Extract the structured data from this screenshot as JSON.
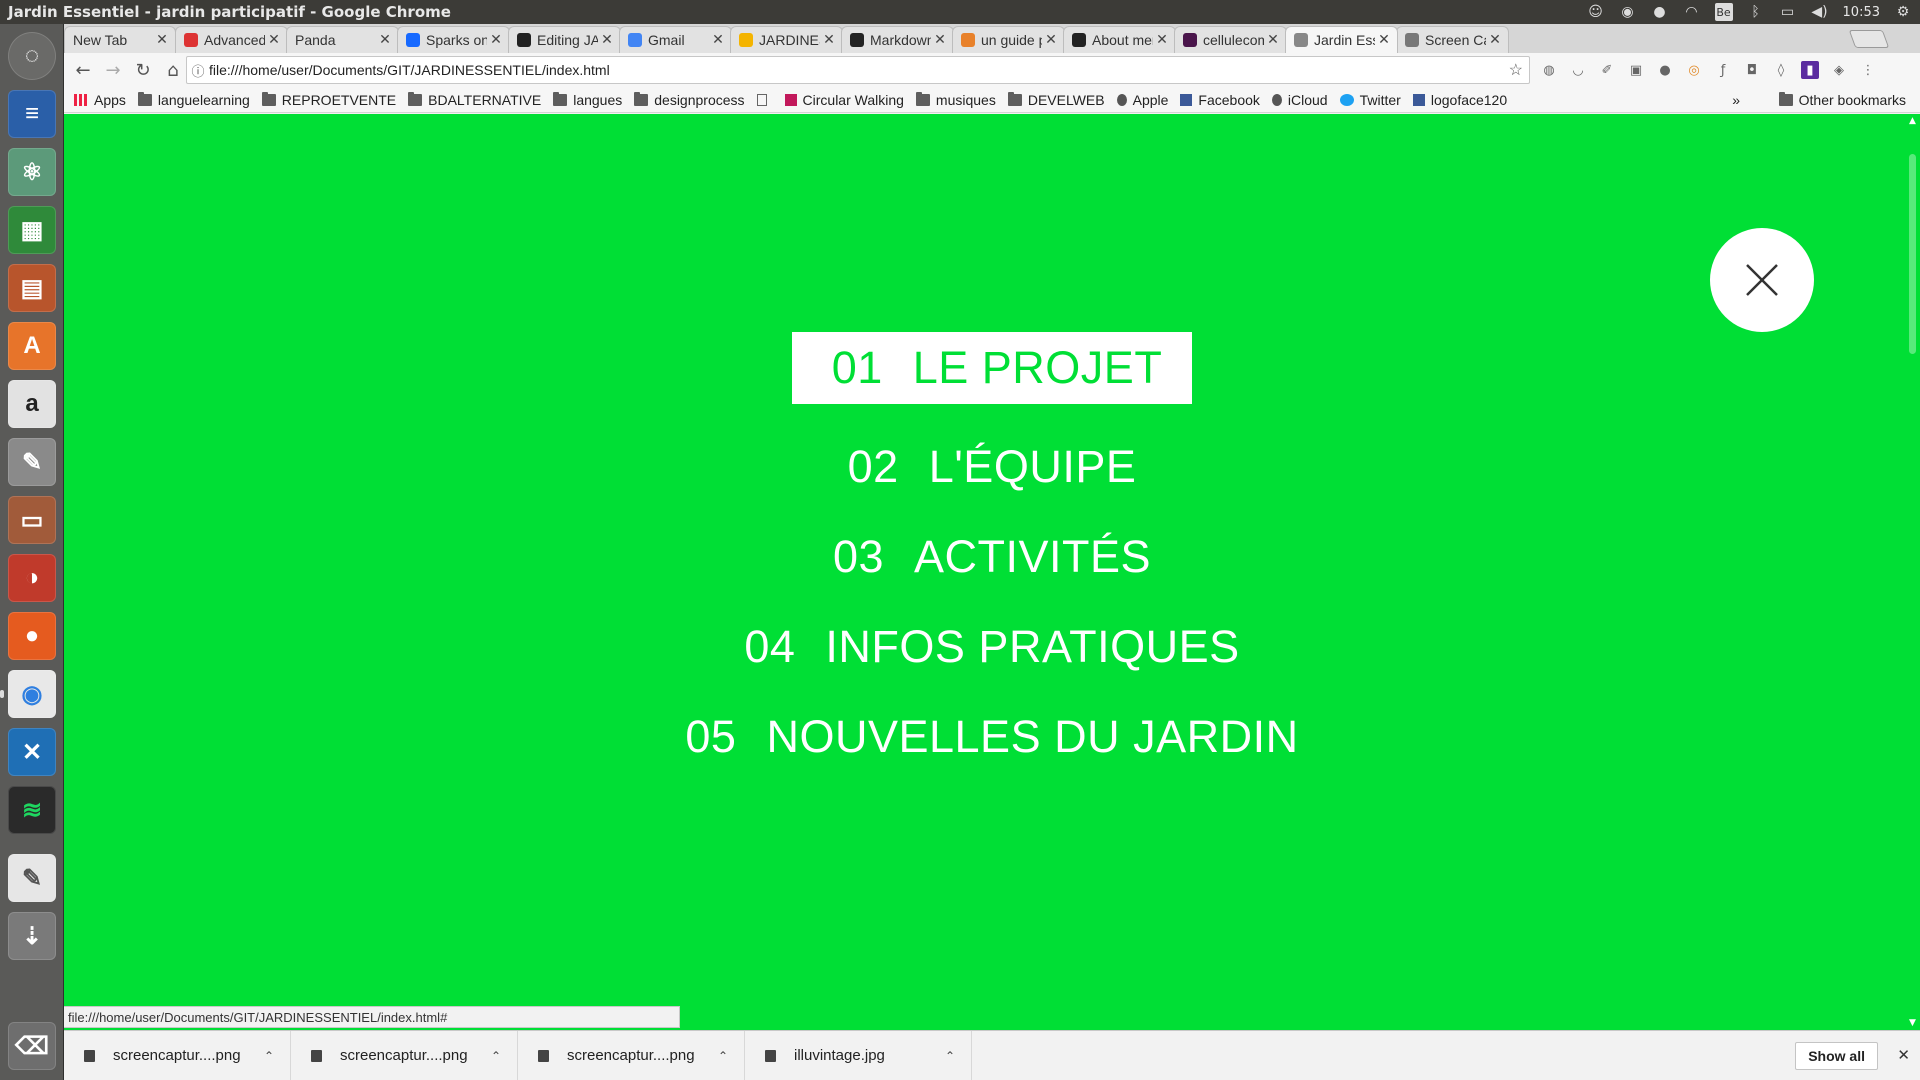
{
  "window_title": "Jardin Essentiel - jardin participatif - Google Chrome",
  "tray": {
    "time": "10:53"
  },
  "tabs": [
    {
      "label": "New Tab",
      "icon": "none"
    },
    {
      "label": "Advanced",
      "icon": "red-logo-icon"
    },
    {
      "label": "Panda",
      "icon": "none"
    },
    {
      "label": "Sparks on",
      "icon": "behance-icon"
    },
    {
      "label": "Editing JA",
      "icon": "github-icon"
    },
    {
      "label": "Gmail",
      "icon": "google-icon"
    },
    {
      "label": "JARDINES",
      "icon": "drive-icon"
    },
    {
      "label": "Markdown",
      "icon": "github-icon"
    },
    {
      "label": "un guide p",
      "icon": "orange-c-icon"
    },
    {
      "label": "About mer",
      "icon": "github-icon"
    },
    {
      "label": "cellulecom",
      "icon": "slack-icon"
    },
    {
      "label": "Jardin Ess",
      "icon": "page-icon"
    },
    {
      "label": "Screen Cap",
      "icon": "camera-icon"
    }
  ],
  "address": "file:///home/user/Documents/GIT/JARDINESSENTIEL/index.html",
  "bookmarks": [
    {
      "label": "Apps",
      "type": "apps"
    },
    {
      "label": "languelearning",
      "type": "folder"
    },
    {
      "label": "REPROETVENTE",
      "type": "folder"
    },
    {
      "label": "BDALTERNATIVE",
      "type": "folder"
    },
    {
      "label": "langues",
      "type": "folder"
    },
    {
      "label": "designprocess",
      "type": "folder"
    },
    {
      "label": "",
      "type": "page"
    },
    {
      "label": "Circular Walking",
      "type": "site"
    },
    {
      "label": "musiques",
      "type": "folder"
    },
    {
      "label": "DEVELWEB",
      "type": "folder"
    },
    {
      "label": "Apple",
      "type": "apple"
    },
    {
      "label": "Facebook",
      "type": "facebook"
    },
    {
      "label": "iCloud",
      "type": "apple"
    },
    {
      "label": "Twitter",
      "type": "twitter"
    },
    {
      "label": "logoface120",
      "type": "facebook"
    }
  ],
  "bookmarks_overflow": "»",
  "other_bookmarks": "Other bookmarks",
  "menu": [
    {
      "number": "01",
      "label": "LE PROJET",
      "active": true
    },
    {
      "number": "02",
      "label": "L'ÉQUIPE",
      "active": false
    },
    {
      "number": "03",
      "label": "ACTIVITÉS",
      "active": false
    },
    {
      "number": "04",
      "label": "INFOS PRATIQUES",
      "active": false
    },
    {
      "number": "05",
      "label": "NOUVELLES DU JARDIN",
      "active": false
    }
  ],
  "status_url": "file:///home/user/Documents/GIT/JARDINESSENTIEL/index.html#",
  "downloads": [
    {
      "name": "screencaptur....png"
    },
    {
      "name": "screencaptur....png"
    },
    {
      "name": "screencaptur....png"
    },
    {
      "name": "illuvintage.jpg"
    }
  ],
  "show_all_label": "Show all",
  "colors": {
    "page_bg": "#00df35",
    "panel": "#3c3b37",
    "launcher": "#5a5a58"
  }
}
